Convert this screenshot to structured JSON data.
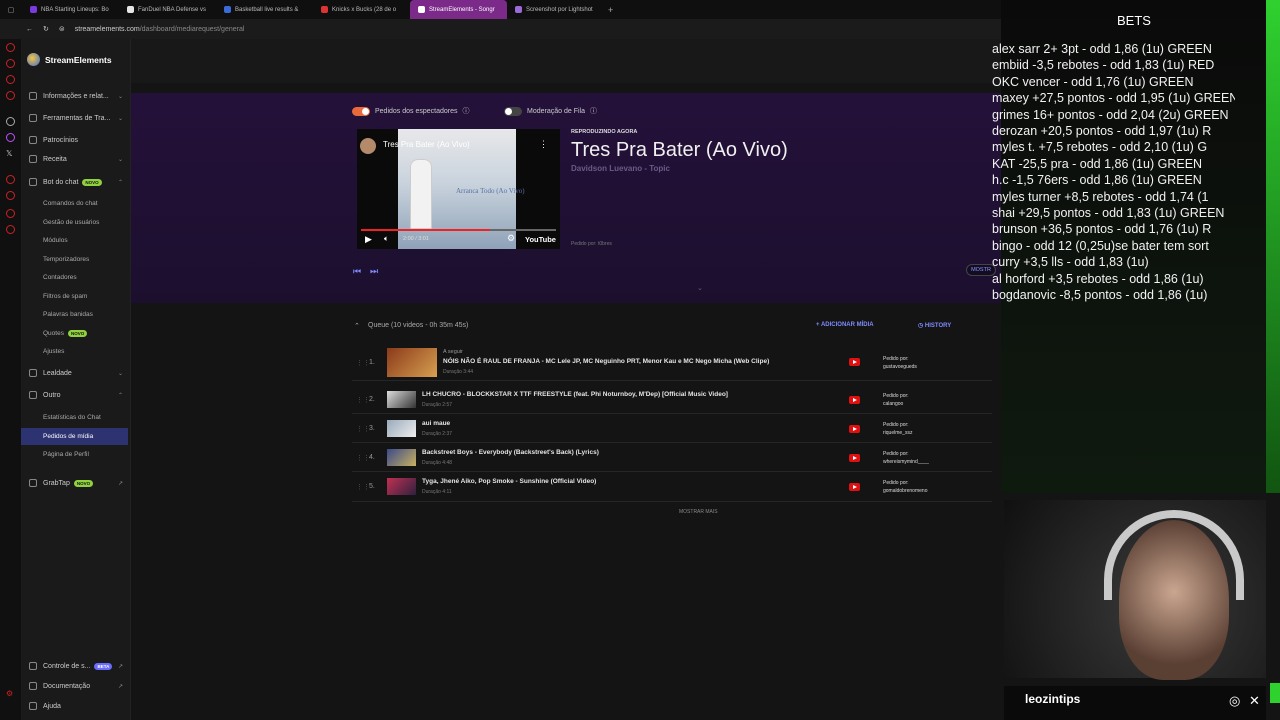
{
  "browser": {
    "tabs": [
      {
        "label": "NBA Starting Lineups: Bo",
        "color": "#7a3ae0"
      },
      {
        "label": "FanDuel NBA Defense vs",
        "color": "#e6e6e6"
      },
      {
        "label": "Basketball live results &",
        "color": "#3a6bd8"
      },
      {
        "label": "Knicks x Bucks (28 de o",
        "color": "#d33"
      },
      {
        "label": "StreamElements - Songr",
        "color": "#fff",
        "active": true
      },
      {
        "label": "Screenshot por Lightshot",
        "color": "#9a6bd8"
      }
    ],
    "url_host": "streamelements.com",
    "url_path": "/dashboard/mediarequest/general"
  },
  "sidebar": {
    "brand": "StreamElements",
    "groups": [
      {
        "label": "Informações e relat...",
        "chevron": "⌄"
      },
      {
        "label": "Ferramentas de Tra...",
        "chevron": "⌄"
      },
      {
        "label": "Patrocínios",
        "chevron": ""
      },
      {
        "label": "Receita",
        "chevron": "⌄"
      },
      {
        "label": "Bot do chat",
        "badge": "NOVO",
        "chevron": "⌃"
      }
    ],
    "bot_items": [
      "Comandos do chat",
      "Gestão de usuários",
      "Módulos",
      "Temporizadores",
      "Contadores",
      "Filtros de spam",
      "Palavras banidas",
      "Quotes",
      "Ajustes"
    ],
    "quotes_badge": "NOVO",
    "lealdade": "Lealdade",
    "outro": "Outro",
    "outro_items": [
      "Estatísticas do Chat",
      "Pedidos de mídia",
      "Página de Perfil"
    ],
    "grabtap": "GrabTap",
    "grabtap_badge": "NOVO",
    "footer": [
      {
        "label": "Controle de s...",
        "badge": "BETA"
      },
      {
        "label": "Documentação",
        "badge": ""
      },
      {
        "label": "Ajuda",
        "badge": ""
      }
    ]
  },
  "player": {
    "toggle_viewers": "Pedidos dos espectadores",
    "toggle_moderation": "Moderação de Fila",
    "video_title": "Tres Pra Bater (Ao Vivo)",
    "video_overlay_text": "Arranca Todo (Ao Vivo)",
    "time": "2:00 / 3:01",
    "progress": 0.66,
    "youtube": "YouTube",
    "now_label": "REPRODUZINDO AGORA",
    "title": "Tres Pra Bater (Ao Vivo)",
    "artist": "Davidson Luevano - Topic",
    "requested_by": "Pedido por: t0bres",
    "show_more_btn": "MOSTR"
  },
  "queue": {
    "header": "Queue (10 videos - 0h 35m 45s)",
    "add_media": "ADICIONAR MÍDIA",
    "history": "HISTORY",
    "next_label": "A seguir",
    "requested_label": "Pedido por:",
    "items": [
      {
        "num": "1.",
        "title": "NÓIS NÃO É RAUL DE FRANJA - MC Lele JP, MC Neguinho PRT, Menor Kau e MC Nego Micha (Web Clipe)",
        "duration": "Duração 3:44",
        "requester": "gustavoegueds"
      },
      {
        "num": "2.",
        "title": "LH CHUCRO - BLOCKKSTAR X TTF FREESTYLE (feat. Phi Noturnboy, M'Dep) [Official Music Video]",
        "duration": "Duração 2:57",
        "requester": "calangoo"
      },
      {
        "num": "3.",
        "title": "aui maue",
        "duration": "Duração 2:37",
        "requester": "riquelme_ssz"
      },
      {
        "num": "4.",
        "title": "Backstreet Boys - Everybody (Backstreet's Back) (Lyrics)",
        "duration": "Duração 4:48",
        "requester": "whereismymind____"
      },
      {
        "num": "5.",
        "title": "Tyga, Jhené Aiko, Pop Smoke - Sunshine (Official Video)",
        "duration": "Duração 4:11",
        "requester": "gomaldobrenomeno"
      }
    ],
    "show_more": "MOSTRAR MAIS"
  },
  "overlay": {
    "title": "BETS",
    "bets": [
      "alex sarr 2+ 3pt - odd 1,86 (1u) GREEN",
      "embiid -3,5 rebotes - odd 1,83 (1u) RED",
      "OKC vencer - odd 1,76 (1u) GREEN",
      "maxey +27,5 pontos - odd 1,95 (1u) GREEN",
      "grimes 16+ pontos - odd 2,04 (2u) GREEN",
      "derozan +20,5 pontos - odd 1,97 (1u) R",
      "myles t. +7,5 rebotes - odd 2,10 (1u) G",
      "KAT -25,5 pra - odd 1,86 (1u) GREEN",
      "h.c -1,5 76ers - odd 1,86 (1u) GREEN",
      "myles turner +8,5 rebotes - odd 1,74 (1",
      "shai +29,5 pontos - odd 1,83 (1u) GREEN",
      "brunson +36,5 pontos - odd 1,76 (1u) R",
      "bingo - odd 12 (0,25u)se bater tem sort",
      "curry +3,5 lls - odd 1,83 (1u)",
      "al horford +3,5 rebotes - odd 1,86 (1u)",
      "bogdanovic -8,5 pontos - odd 1,86 (1u)"
    ],
    "streamer": "leozintips"
  }
}
